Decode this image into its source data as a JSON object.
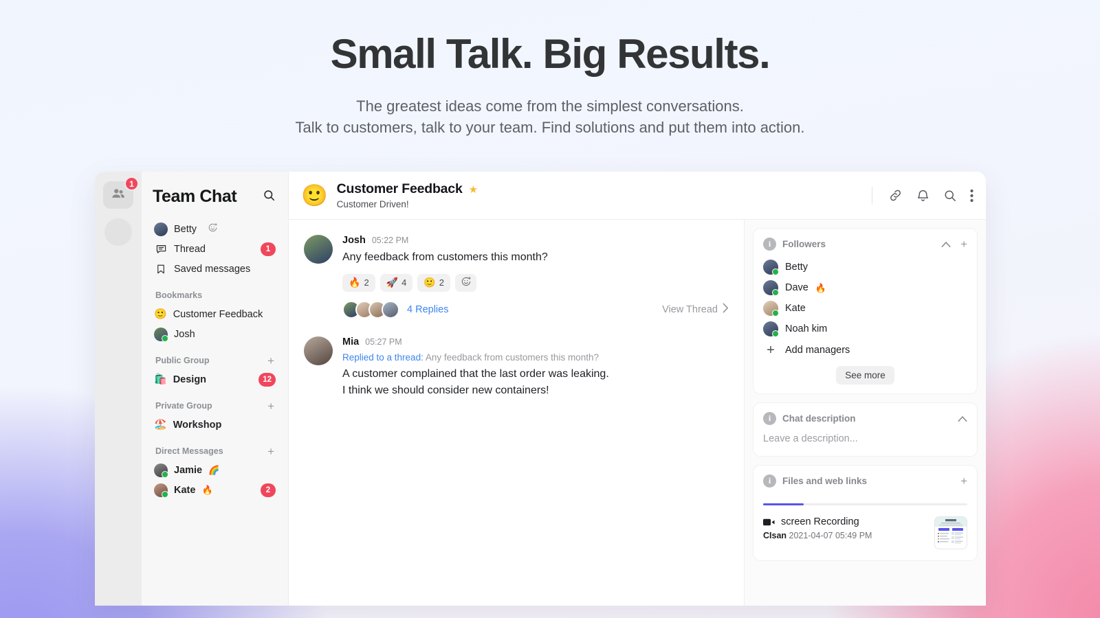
{
  "hero": {
    "title": "Small Talk. Big Results.",
    "sub_line1": "The greatest ideas come from the simplest conversations.",
    "sub_line2": "Talk to customers, talk to your team. Find solutions and put them into action."
  },
  "rail": {
    "badge": "1",
    "people_icon": "people-icon"
  },
  "sidebar": {
    "title": "Team Chat",
    "search_icon": "search-icon",
    "top_items": [
      {
        "label": "Betty",
        "kind": "avatar",
        "status_icon": "add-reaction-icon"
      },
      {
        "label": "Thread",
        "kind": "thread-icon",
        "badge": "1"
      },
      {
        "label": "Saved messages",
        "kind": "bookmark-icon"
      }
    ],
    "sections": [
      {
        "title": "Bookmarks",
        "has_add": false,
        "items": [
          {
            "label": "Customer Feedback",
            "emoji": "🙂",
            "bold": false
          },
          {
            "label": "Josh",
            "kind": "avatar",
            "bold": false,
            "online": true
          }
        ]
      },
      {
        "title": "Public Group",
        "has_add": true,
        "items": [
          {
            "label": "Design",
            "emoji": "🛍️",
            "bold": true,
            "badge": "12"
          }
        ]
      },
      {
        "title": "Private Group",
        "has_add": true,
        "items": [
          {
            "label": "Workshop",
            "emoji": "🏖️",
            "bold": true,
            "lock": true
          }
        ]
      },
      {
        "title": "Direct Messages",
        "has_add": true,
        "items": [
          {
            "label": "Jamie",
            "kind": "avatar",
            "bold": true,
            "online": true,
            "trailing_emoji": "🌈"
          },
          {
            "label": "Kate",
            "kind": "avatar",
            "bold": true,
            "online": true,
            "trailing_emoji": "🔥",
            "badge": "2"
          }
        ]
      }
    ]
  },
  "channel": {
    "emoji": "🙂",
    "title": "Customer Feedback",
    "starred_icon": "star-icon",
    "subtitle": "Customer Driven!",
    "tools": [
      "link-icon",
      "bell-icon",
      "search-icon",
      "more-vertical-icon"
    ]
  },
  "messages": [
    {
      "author": "Josh",
      "time": "05:22 PM",
      "text": "Any feedback from customers this month?",
      "reactions": [
        {
          "emoji": "🔥",
          "count": "2"
        },
        {
          "emoji": "🚀",
          "count": "4"
        },
        {
          "emoji": "🙂",
          "count": "2"
        }
      ],
      "add_reaction_icon": "add-reaction-icon",
      "replies_label": "4 Replies",
      "view_thread_label": "View Thread",
      "chevron_icon": "chevron-right-icon"
    },
    {
      "author": "Mia",
      "time": "05:27 PM",
      "quote_prefix": "Replied to a thread:",
      "quote_text": "Any feedback from customers this month?",
      "text_line1": "A customer complained that the last order was leaking.",
      "text_line2": "I think we should consider new containers!"
    }
  ],
  "panel": {
    "followers": {
      "info_icon": "info-icon",
      "title": "Followers",
      "collapse_icon": "chevron-up-icon",
      "add_icon": "plus-icon",
      "people": [
        {
          "name": "Betty",
          "online": true
        },
        {
          "name": "Dave",
          "online": true,
          "emoji": "🔥"
        },
        {
          "name": "Kate",
          "online": true
        },
        {
          "name": "Noah kim",
          "online": true
        }
      ],
      "add_managers_label": "Add managers",
      "see_more_label": "See more"
    },
    "description": {
      "info_icon": "info-icon",
      "title": "Chat description",
      "collapse_icon": "chevron-up-icon",
      "placeholder": "Leave a description..."
    },
    "files": {
      "info_icon": "info-icon",
      "title": "Files and web links",
      "add_icon": "plus-icon",
      "item": {
        "video_icon": "video-camera-icon",
        "name": "screen Recording",
        "uploader": "CIsan",
        "timestamp": "2021-04-07 05:49 PM"
      }
    }
  },
  "colors": {
    "accent_blue": "#3b86f0",
    "badge_red": "#f0475c",
    "progress_purple": "#5b54e8",
    "online_green": "#23b24b",
    "star_yellow": "#f3bc2e"
  }
}
